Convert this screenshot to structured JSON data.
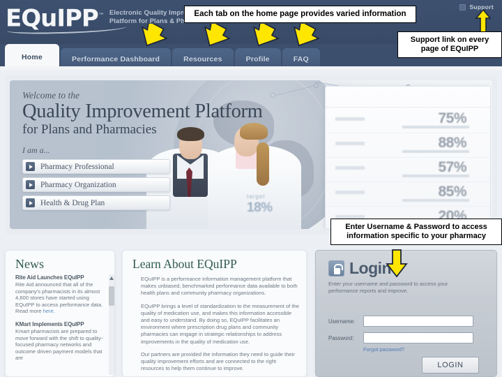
{
  "header": {
    "logo_main": "EQuIPP",
    "logo_tm": "™",
    "logo_tagline_1": "Electronic Quality Improvement",
    "logo_tagline_2": "Platform for Plans & Pharmacies",
    "support_label": "Support",
    "support_icon": "support-icon",
    "bg_color": "#3c4f6c"
  },
  "tabs": [
    {
      "label": "Home",
      "active": true
    },
    {
      "label": "Performance Dashboard",
      "active": false
    },
    {
      "label": "Resources",
      "active": false
    },
    {
      "label": "Profile",
      "active": false
    },
    {
      "label": "FAQ",
      "active": false
    }
  ],
  "hero": {
    "welcome": "Welcome to the",
    "headline": "Quality Improvement Platform",
    "subhead": "for Plans and Pharmacies",
    "i_am_a": "I am a...",
    "roles": [
      {
        "label": "Pharmacy Professional"
      },
      {
        "label": "Pharmacy Organization"
      },
      {
        "label": "Health & Drug Plan"
      }
    ],
    "overlay_target_label": "target",
    "overlay_target_value": "18%",
    "stats": [
      {
        "value": "75%"
      },
      {
        "value": "88%"
      },
      {
        "value": "57%"
      },
      {
        "value": "85%"
      },
      {
        "value": "20%"
      }
    ]
  },
  "news": {
    "title": "News",
    "items": [
      {
        "headline": "Rite Aid Launches EQuIPP",
        "body": "Rite Aid announced that all of the company's pharmacists in its almost 4,600 stores have started using EQuIPP to access performance data. Read more ",
        "link": "here."
      },
      {
        "headline": "KMart Implements EQuIPP",
        "body": "Kmart pharmacists are prepared to move forward with the shift to quality-focused pharmacy networks and outcome driven payment models that are",
        "link": ""
      }
    ]
  },
  "learn": {
    "title": "Learn About EQuIPP",
    "paragraphs": [
      "EQuIPP is a performance information management platform that makes unbiased, benchmarked performance data available to both health plans and community pharmacy organizations.",
      "EQuIPP brings a level of standardization to the measurement of the quality of medication use, and makes this information accessible and easy to understand. By doing so, EQuIPP facilitates an environment where prescription drug plans and community pharmacies can engage in strategic relationships to address improvements in the quality of medication use.",
      "Our partners are provided the information they need to guide their quality improvement efforts and are connected to the right resources to help them continue to improve."
    ]
  },
  "login": {
    "title": "Login",
    "lock_icon": "lock-icon",
    "subtitle": "Enter your username and password to access your performance reports and improve.",
    "username_label": "Username:",
    "username_value": "",
    "username_placeholder": "",
    "password_label": "Password:",
    "password_value": "",
    "password_placeholder": "",
    "forgot_label": "Forgot password?",
    "button_label": "LOGIN"
  },
  "annotations": {
    "callout_tabs": "Each tab on the home page provides varied information",
    "callout_support": "Support link on every page of EQuIPP",
    "callout_login": "Enter Username & Password to access information specific to your pharmacy",
    "arrow_color": "#ffe600"
  }
}
